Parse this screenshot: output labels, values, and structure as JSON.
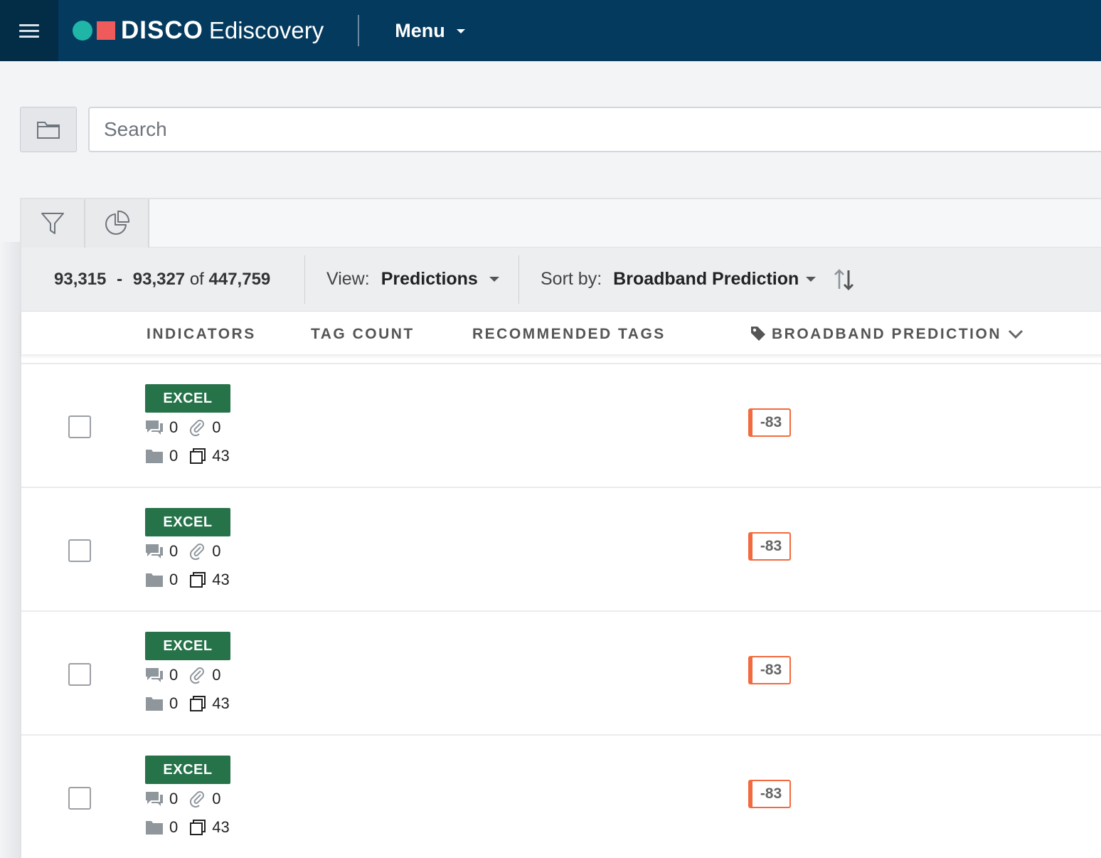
{
  "header": {
    "brand_name": "DISCO",
    "brand_sub": "Ediscovery",
    "menu_label": "Menu"
  },
  "search": {
    "placeholder": "Search"
  },
  "toolbar": {
    "range_start": "93,315",
    "range_sep": "-",
    "range_end": "93,327",
    "range_of": "of",
    "range_total": "447,759",
    "view_label": "View:",
    "view_value": "Predictions",
    "sort_label": "Sort by:",
    "sort_value": "Broadband Prediction"
  },
  "columns": {
    "indicators": "INDICATORS",
    "tag_count": "TAG COUNT",
    "recommended_tags": "RECOMMENDED TAGS",
    "broadband_prediction": "BROADBAND PREDICTION"
  },
  "rows": [
    {
      "badge": "EXCEL",
      "comments": "0",
      "attachments": "0",
      "folders": "0",
      "pages": "43",
      "prediction": "-83"
    },
    {
      "badge": "EXCEL",
      "comments": "0",
      "attachments": "0",
      "folders": "0",
      "pages": "43",
      "prediction": "-83"
    },
    {
      "badge": "EXCEL",
      "comments": "0",
      "attachments": "0",
      "folders": "0",
      "pages": "43",
      "prediction": "-83"
    },
    {
      "badge": "EXCEL",
      "comments": "0",
      "attachments": "0",
      "folders": "0",
      "pages": "43",
      "prediction": "-83"
    }
  ],
  "colors": {
    "topbar": "#043a5e",
    "logo_teal": "#1fb5a7",
    "logo_red": "#ef5a5b",
    "excel_badge": "#26734a",
    "prediction_accent": "#f26a3d"
  },
  "icons": [
    "hamburger-icon",
    "folder-icon",
    "filter-icon",
    "pie-chart-icon",
    "sort-icon",
    "tag-icon",
    "chevron-down-icon",
    "comment-icon",
    "paperclip-icon",
    "folder-small-icon",
    "pages-icon"
  ]
}
